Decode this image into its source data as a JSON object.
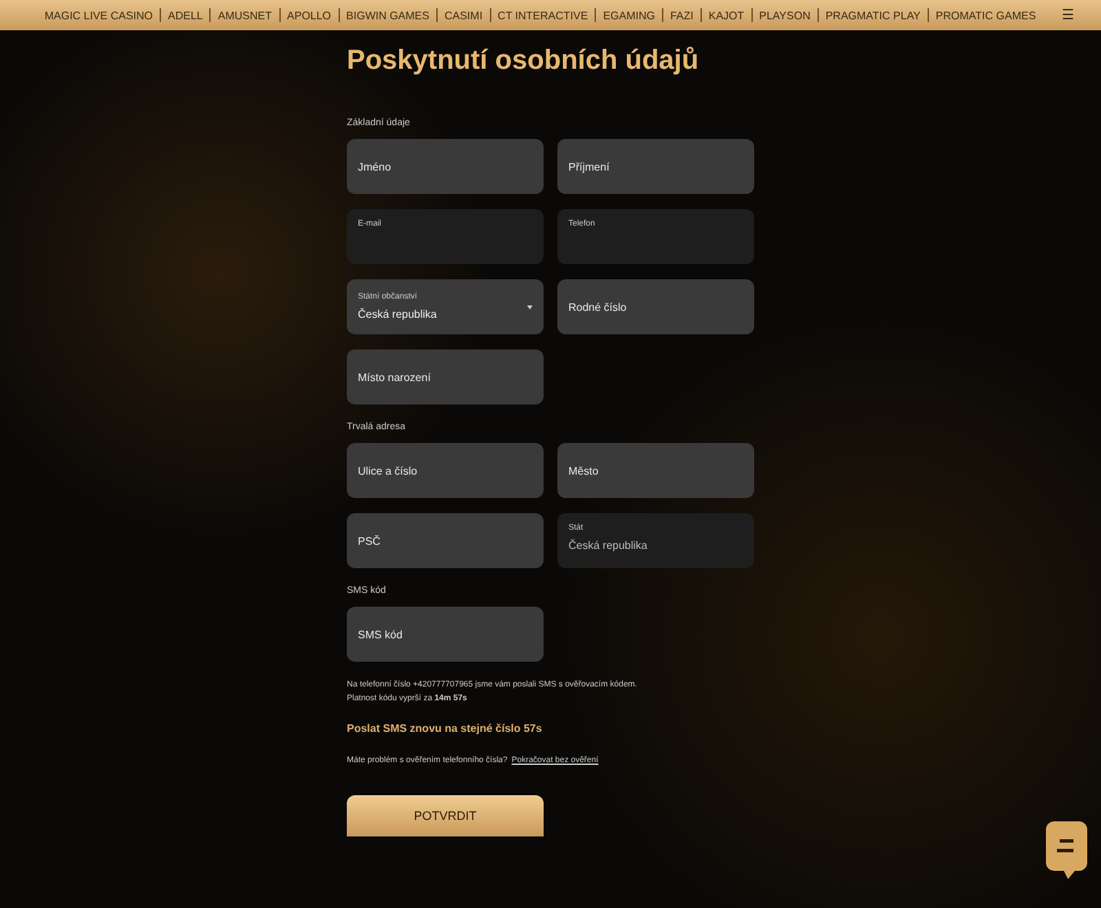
{
  "nav": {
    "items": [
      "MAGIC LIVE CASINO",
      "ADELL",
      "AMUSNET",
      "APOLLO",
      "BIGWIN GAMES",
      "CASIMI",
      "CT INTERACTIVE",
      "EGAMING",
      "FAZI",
      "KAJOT",
      "PLAYSON",
      "PRAGMATIC PLAY",
      "PROMATIC GAMES"
    ],
    "menu_icon": "☰"
  },
  "title": "Poskytnutí osobních údajů",
  "sections": [
    {
      "label": "Základní údaje",
      "rows": [
        [
          {
            "kind": "plain",
            "label": "Jméno"
          },
          {
            "kind": "plain",
            "label": "Příjmení"
          }
        ],
        [
          {
            "kind": "floating",
            "label": "E-mail"
          },
          {
            "kind": "floating",
            "label": "Telefon"
          }
        ],
        [
          {
            "kind": "select",
            "label": "Státní občanství",
            "value": "Česká republika"
          },
          {
            "kind": "plain",
            "label": "Rodné číslo"
          }
        ],
        [
          {
            "kind": "plain",
            "label": "Místo narození"
          }
        ]
      ]
    },
    {
      "label": "Trvalá adresa",
      "rows": [
        [
          {
            "kind": "plain",
            "label": "Ulice a číslo"
          },
          {
            "kind": "plain",
            "label": "Město"
          }
        ],
        [
          {
            "kind": "plain",
            "label": "PSČ"
          },
          {
            "kind": "floating",
            "label": "Stát",
            "value": "Česká republika"
          }
        ]
      ]
    },
    {
      "label": "SMS kód",
      "rows": [
        [
          {
            "kind": "plain",
            "label": "SMS kód"
          }
        ]
      ]
    }
  ],
  "info_lines": [
    "Na telefonní číslo +420777707965 jsme vám poslali SMS s ověřovacím kódem.",
    "Platnost kódu vyprší za **14m 57s**"
  ],
  "resend": "Poslat SMS znovu na stejné číslo 57s",
  "problem": {
    "text": "Máte problém s ověřením telefonního čísla?",
    "link": "Pokračovat bez ověření"
  },
  "submit": "POTVRDIT"
}
